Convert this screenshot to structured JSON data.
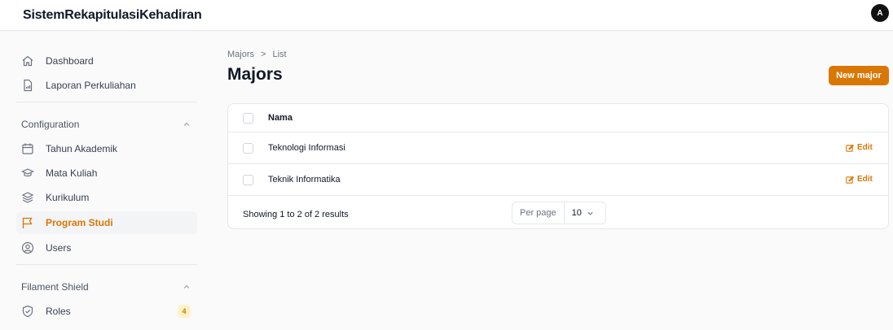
{
  "app": {
    "brand": "SistemRekapitulasiKehadiran",
    "avatar_initial": "A"
  },
  "sidebar": {
    "top_items": [
      {
        "label": "Dashboard",
        "icon": "home-icon"
      },
      {
        "label": "Laporan Perkuliahan",
        "icon": "document-chart-icon"
      }
    ],
    "groups": [
      {
        "label": "Configuration",
        "items": [
          {
            "label": "Tahun Akademik",
            "icon": "calendar-icon"
          },
          {
            "label": "Mata Kuliah",
            "icon": "academic-cap-icon"
          },
          {
            "label": "Kurikulum",
            "icon": "stack-icon"
          },
          {
            "label": "Program Studi",
            "icon": "flag-icon",
            "active": true
          },
          {
            "label": "Users",
            "icon": "user-circle-icon"
          }
        ]
      },
      {
        "label": "Filament Shield",
        "items": [
          {
            "label": "Roles",
            "icon": "shield-check-icon",
            "badge": "4"
          }
        ]
      }
    ]
  },
  "breadcrumb": {
    "parent": "Majors",
    "separator": ">",
    "current": "List"
  },
  "page": {
    "title": "Majors",
    "new_button": "New major"
  },
  "table": {
    "column_header": "Nama",
    "rows": [
      {
        "nama": "Teknologi Informasi",
        "action": "Edit"
      },
      {
        "nama": "Teknik Informatika",
        "action": "Edit"
      }
    ],
    "footer": {
      "summary": "Showing 1 to 2 of 2 results",
      "per_page_label": "Per page",
      "per_page_value": "10"
    }
  },
  "colors": {
    "accent": "#d97706",
    "badge_bg": "#fef3c7",
    "active_bg": "#f3f4f6"
  }
}
